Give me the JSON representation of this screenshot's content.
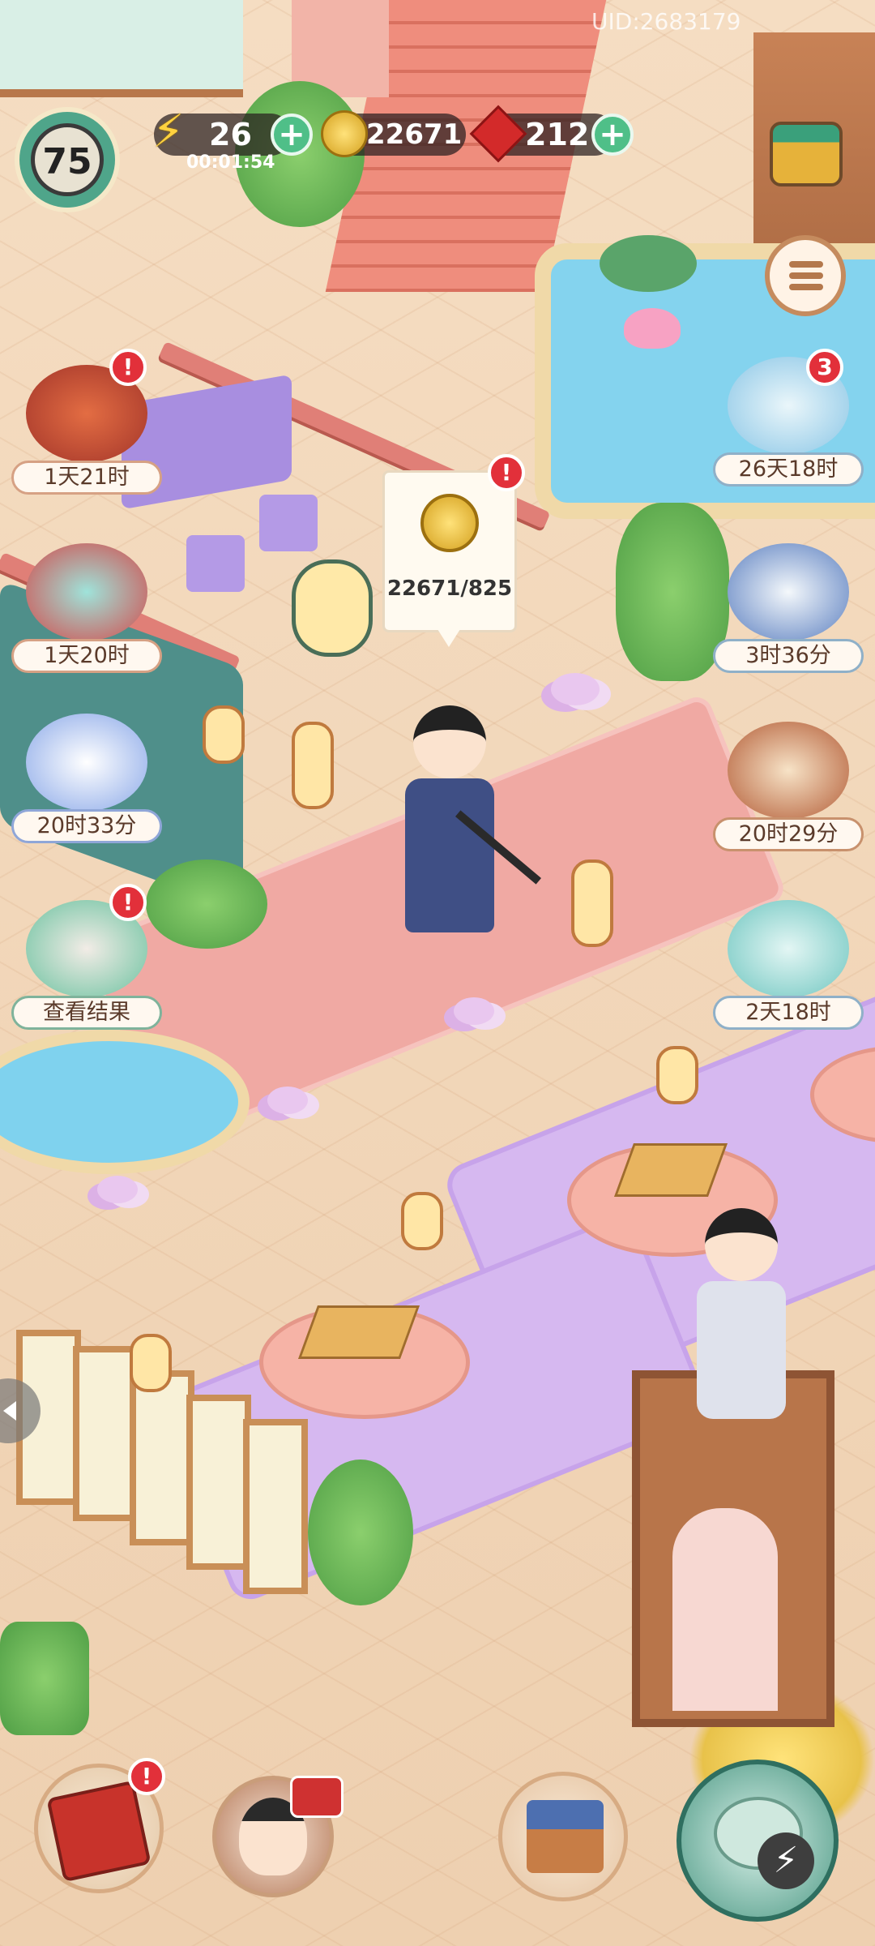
{
  "hud": {
    "uid": "UID:2683179",
    "level": "75",
    "energy": "26",
    "energy_timer": "00:01:54",
    "coins": "22671",
    "gems": "212"
  },
  "icons": {
    "energy": "lightning-icon",
    "coin": "coin-icon",
    "gem": "ruby-gem-icon",
    "menu": "list-menu-icon",
    "shop": "golden-shrine-icon"
  },
  "left_events": [
    {
      "label": "1天21时",
      "badge": "!",
      "icon": "book-scroll-icon"
    },
    {
      "label": "1天20时",
      "badge": "",
      "icon": "cat-drum-icon"
    },
    {
      "label": "20时33分",
      "badge": "",
      "icon": "spirit-fan-icon"
    },
    {
      "label": "查看结果",
      "badge": "!",
      "icon": "hat-character-icon"
    }
  ],
  "right_events": [
    {
      "label": "26天18时",
      "badge": "3",
      "icon": "spirit-beast-icon"
    },
    {
      "label": "3时36分",
      "badge": "",
      "icon": "snow-scene-icon"
    },
    {
      "label": "20时29分",
      "badge": "",
      "icon": "cards-icon"
    },
    {
      "label": "2天18时",
      "badge": "",
      "icon": "gift-box-beast-icon"
    }
  ],
  "coin_bubble": {
    "value": "22671/825",
    "badge": "!"
  },
  "bottom_bar": {
    "book_badge": "!",
    "items": [
      "book-icon",
      "character-portrait-icon",
      "house-icon",
      "teapot-icon"
    ]
  },
  "colors": {
    "badge": "#e2303a",
    "plus": "#4fbf88",
    "carpet": "#f0a9a3",
    "rug": "#d6b8f0",
    "floor": "#f3d7b7"
  }
}
